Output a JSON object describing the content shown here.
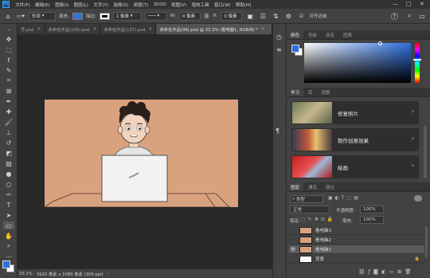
{
  "app": {
    "logo": "Ps"
  },
  "menu": [
    "文件(F)",
    "编辑(E)",
    "图像(I)",
    "图层(L)",
    "文字(Y)",
    "选择(S)",
    "滤镜(T)",
    "3D(D)",
    "视图(V)",
    "增效工具",
    "窗口(W)",
    "帮助(H)"
  ],
  "window_controls": [
    "—",
    "□",
    "✕"
  ],
  "options": {
    "shape_mode": "形状",
    "fill_label": "填充:",
    "stroke_label": "描边:",
    "stroke_width": "1 像素",
    "w_label": "W:",
    "w_value": "0 像素",
    "h_label": "H:",
    "h_value": "0 像素",
    "align_edges": "对齐边缘",
    "fill_color": "#3a6fd8",
    "stroke_color": "#ffffff"
  },
  "tabs": [
    {
      "label": "号.psd",
      "active": false
    },
    {
      "label": "未命名作品(109).psd",
      "active": false
    },
    {
      "label": "未命名作品(137).psd",
      "active": false
    },
    {
      "label": "未命名作品(98).psd @ 33.3% (看电脑1, RGB/8) *",
      "active": true
    }
  ],
  "tools": [
    "move",
    "marquee",
    "lasso",
    "quick-select",
    "crop",
    "frame",
    "eyedropper",
    "healing",
    "brush",
    "stamp",
    "history-brush",
    "eraser",
    "gradient",
    "blur",
    "dodge",
    "pen",
    "type",
    "path-select",
    "rectangle",
    "hand",
    "zoom",
    "more"
  ],
  "status": {
    "zoom": "33.3%",
    "doc_size": "3920 像素 x 1080 像素 (300 ppi)",
    "arrow": "›"
  },
  "color_panel": {
    "tabs": [
      "颜色",
      "色板",
      "渐变",
      "图案"
    ],
    "fg_color": "#2d6fe0",
    "bg_color": "#ffffff"
  },
  "learn_panel": {
    "tabs": [
      "学习",
      "库",
      "调整"
    ],
    "cards": [
      {
        "label": "修复照片"
      },
      {
        "label": "制作创意效果"
      },
      {
        "label": "绘画"
      }
    ]
  },
  "layers_panel": {
    "tabs": [
      "图层",
      "通道",
      "路径"
    ],
    "filter_kind": "类型",
    "blend_mode": "正常",
    "opacity_label": "不透明度:",
    "opacity": "100%",
    "lock_label": "锁定:",
    "fill_label": "填充:",
    "fill": "100%",
    "layers": [
      {
        "name": "看电脑3",
        "visible": false,
        "selected": false
      },
      {
        "name": "看电脑2",
        "visible": false,
        "selected": false
      },
      {
        "name": "看电脑1",
        "visible": true,
        "selected": true
      },
      {
        "name": "背景",
        "visible": false,
        "selected": false
      }
    ],
    "footer_icons": [
      "link-icon",
      "fx-icon",
      "mask-icon",
      "adjust-icon",
      "group-icon",
      "new-layer-icon",
      "trash-icon"
    ]
  }
}
